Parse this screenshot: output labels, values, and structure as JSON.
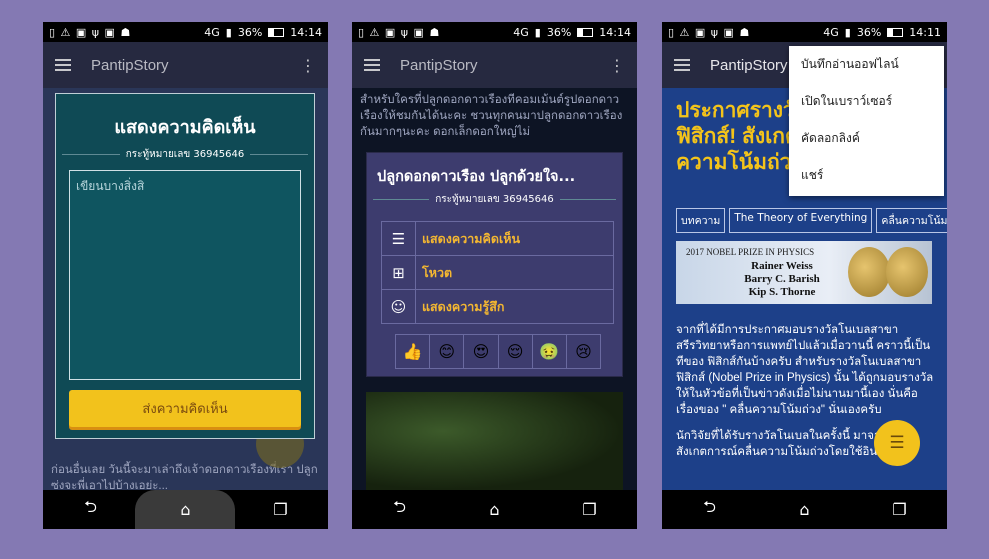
{
  "status": {
    "icons": [
      "▯",
      "⚠",
      "▣",
      "ψ",
      "▣",
      "☗"
    ],
    "network": "4G",
    "battery": "36%"
  },
  "phones": [
    {
      "time": "14:14",
      "app_title": "PantipStory",
      "dialog_title": "แสดงความคิดเห็น",
      "topic_line": "กระทู้หมายเลข 36945646",
      "textarea_placeholder": "เขียนบางสิ่งสิ",
      "send_button": "ส่งความคิดเห็น",
      "bg_text": "ก่อนอื่นเลย วันนี้จะมาเล่าถึงเจ้าดอกดาวเรืองที่เรา ปลูก ซ่งจะพี่เอาไปบ้างเอย่ะ..."
    },
    {
      "time": "14:14",
      "app_title": "PantipStory",
      "bg_text": "สำหรับใครที่ปลูกดอกดาวเรืองทีคอมเม้นต์รูปดอกดาวเรืองให้ชมกันได้นะคะ ชวนทุกคนมาปลูกดอกดาวเรืองกันมากๆนะคะ ดอกเล็กดอกใหญ่ไม่",
      "dialog_title": "ปลูกดอกดาวเรือง ปลูกด้วยใจ...",
      "topic_line": "กระทู้หมายเลข 36945646",
      "options": [
        {
          "icon": "☰",
          "label": "แสดงความคิดเห็น"
        },
        {
          "icon": "⊞",
          "label": "โหวต"
        },
        {
          "icon": "☺",
          "label": "แสดงความรู้สึก"
        }
      ],
      "emotions": [
        "👍",
        "😊",
        "😍",
        "😌",
        "🤢",
        "😢"
      ]
    },
    {
      "time": "14:11",
      "app_title": "PantipStory",
      "headline": "ประกาศรางวัลโนเบล สาขาฟิสิกส์! สังเกตการณ์คลื่นความโน้มถ่วงโดยตัวตรวจ",
      "tags": [
        "บทความ",
        "The Theory of Everything",
        "คลื่นความโน้มถ่วง"
      ],
      "nobel": {
        "header": "2017 NOBEL PRIZE IN PHYSICS",
        "names": [
          "Rainer Weiss",
          "Barry C. Barish",
          "Kip S. Thorne"
        ]
      },
      "article": [
        "จากที่ได้มีการประกาศมอบรางวัลโนเบลสาขาสรีรวิทยาหรือการแพทย์ไปแล้วเมื่อวานนี้ คราวนี้เป็นทีของ ฟิสิกส์กันบ้างครับ สำหรับรางวัลโนเบลสาขาฟิสิกส์ (Nobel Prize in Physics) นั้น ได้ถูกมอบรางวัลให้ในหัวข้อที่เป็นข่าวดังเมื่อไม่นานมานี้เอง นั่นคือเรื่องของ \" คลื่นความโน้มถ่วง\" นั่นเองครับ",
        "นักวิจัยที่ได้รับรางวัลโนเบลในครั้งนี้ มาจากหอสังเกตการณ์คลื่นความโน้มถ่วงโดยใช้อินเต"
      ],
      "menu": [
        "บันทึกอ่านออฟไลน์",
        "เปิดในเบราว์เซอร์",
        "คัดลอกลิงค์",
        "แชร์"
      ]
    }
  ],
  "nav": {
    "back": "⮌",
    "home": "⌂",
    "recents": "❐"
  }
}
